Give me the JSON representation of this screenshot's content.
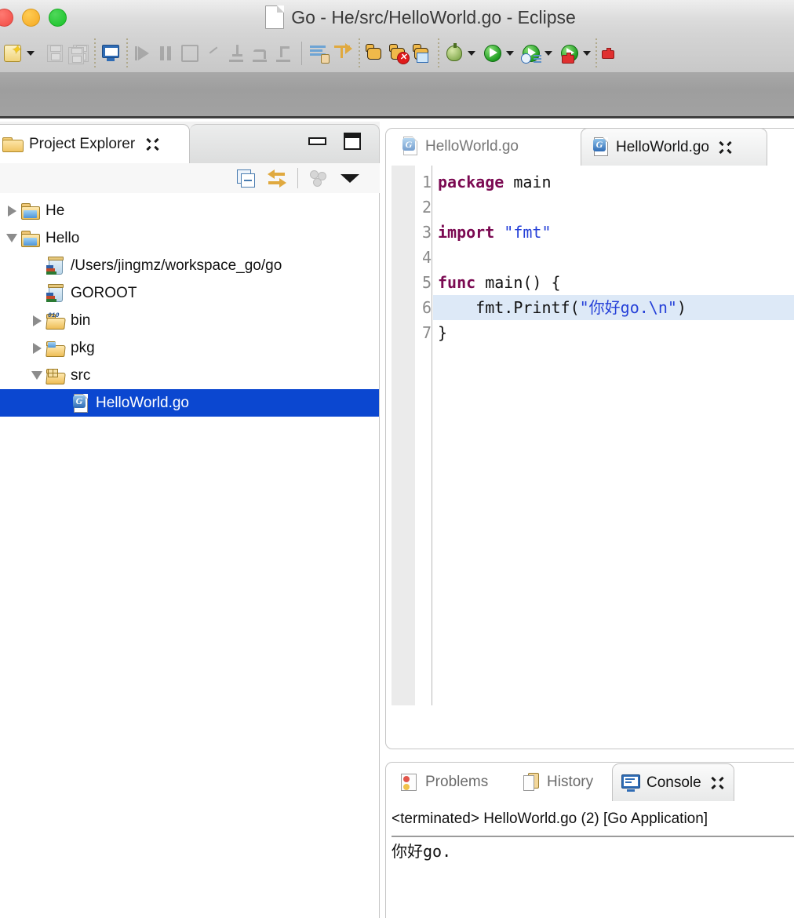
{
  "window": {
    "title": "Go - He/src/HelloWorld.go - Eclipse",
    "doc_icon": "document-icon",
    "traffic_lights": [
      "close",
      "minimize",
      "zoom"
    ]
  },
  "toolbar": {
    "items": [
      {
        "name": "new-wizard-button",
        "icon": "new-icon",
        "dropdown": true,
        "enabled": true
      },
      {
        "name": "save-button",
        "icon": "save-icon",
        "enabled": false
      },
      {
        "name": "save-all-button",
        "icon": "save-all-icon",
        "enabled": false
      },
      {
        "name": "open-console-button",
        "icon": "console-icon",
        "enabled": true
      },
      {
        "name": "resume-button",
        "icon": "play-icon",
        "enabled": false
      },
      {
        "name": "suspend-button",
        "icon": "pause-icon",
        "enabled": false
      },
      {
        "name": "terminate-button",
        "icon": "stop-icon",
        "enabled": false
      },
      {
        "name": "disconnect-button",
        "icon": "disconnect-icon",
        "enabled": false
      },
      {
        "name": "step-into-button",
        "icon": "step-into-icon",
        "enabled": false
      },
      {
        "name": "step-over-button",
        "icon": "step-over-icon",
        "enabled": false
      },
      {
        "name": "step-return-button",
        "icon": "step-return-icon",
        "enabled": false
      },
      {
        "name": "show-whitespace-button",
        "icon": "lines-hand-icon",
        "enabled": true
      },
      {
        "name": "next-annotation-button",
        "icon": "yellow-arrow-icon",
        "enabled": true
      },
      {
        "name": "ant-build-button",
        "icon": "ant-cat-icon",
        "enabled": true
      },
      {
        "name": "ant-clean-button",
        "icon": "ant-cat-error-icon",
        "enabled": true
      },
      {
        "name": "ant-view-button",
        "icon": "ant-cat-view-icon",
        "enabled": true
      },
      {
        "name": "debug-button",
        "icon": "bug-icon",
        "dropdown": true,
        "enabled": true
      },
      {
        "name": "run-button",
        "icon": "run-green-icon",
        "dropdown": true,
        "enabled": true
      },
      {
        "name": "run-history-button",
        "icon": "run-history-icon",
        "dropdown": true,
        "enabled": true
      },
      {
        "name": "external-tools-button",
        "icon": "external-tools-icon",
        "dropdown": true,
        "enabled": true
      }
    ]
  },
  "project_explorer": {
    "tab_label": "Project Explorer",
    "tab_icon": "folder-icon",
    "close_icon": "close-icon",
    "minimize_icon": "minimize-icon",
    "maximize_icon": "maximize-icon",
    "view_toolbar": [
      {
        "name": "collapse-all-button",
        "icon": "collapse-all-icon",
        "enabled": true
      },
      {
        "name": "link-with-editor-button",
        "icon": "link-editor-icon",
        "enabled": true
      },
      {
        "name": "filters-button",
        "icon": "filters-icon",
        "enabled": false
      },
      {
        "name": "view-menu-button",
        "icon": "chevron-down-icon",
        "enabled": true
      }
    ],
    "tree": [
      {
        "label": "He",
        "icon": "project-folder-icon",
        "twisty": "collapsed",
        "indent": 0,
        "selected": false
      },
      {
        "label": "Hello",
        "icon": "project-folder-icon",
        "twisty": "expanded",
        "indent": 0,
        "selected": false
      },
      {
        "label": "/Users/jingmz/workspace_go/go",
        "icon": "library-icon",
        "twisty": "none",
        "indent": 1,
        "selected": false
      },
      {
        "label": "GOROOT",
        "icon": "library-icon",
        "twisty": "none",
        "indent": 1,
        "selected": false
      },
      {
        "label": "bin",
        "icon": "bin-folder-icon",
        "twisty": "collapsed",
        "indent": 1,
        "selected": false
      },
      {
        "label": "pkg",
        "icon": "pkg-folder-icon",
        "twisty": "collapsed",
        "indent": 1,
        "selected": false
      },
      {
        "label": "src",
        "icon": "src-folder-icon",
        "twisty": "expanded",
        "indent": 1,
        "selected": false
      },
      {
        "label": "HelloWorld.go",
        "icon": "go-file-icon",
        "twisty": "none",
        "indent": 2,
        "selected": true
      }
    ],
    "selection_color": "#0b47d0"
  },
  "editor": {
    "tabs": [
      {
        "label": "HelloWorld.go",
        "icon": "go-file-icon",
        "active": false,
        "closable": false
      },
      {
        "label": "HelloWorld.go",
        "icon": "go-file-icon",
        "active": true,
        "closable": true
      }
    ],
    "close_icon": "close-icon",
    "highlighted_line": 6,
    "line_numbers": [
      "1",
      "2",
      "3",
      "4",
      "5",
      "6",
      "7"
    ],
    "lines": [
      {
        "n": 1,
        "tokens": [
          {
            "t": "package ",
            "c": "kw"
          },
          {
            "t": "main",
            "c": ""
          }
        ]
      },
      {
        "n": 2,
        "tokens": [
          {
            "t": "",
            "c": ""
          }
        ]
      },
      {
        "n": 3,
        "tokens": [
          {
            "t": "import ",
            "c": "kw"
          },
          {
            "t": "\"fmt\"",
            "c": "str"
          }
        ]
      },
      {
        "n": 4,
        "tokens": [
          {
            "t": "",
            "c": ""
          }
        ]
      },
      {
        "n": 5,
        "tokens": [
          {
            "t": "func ",
            "c": "kw"
          },
          {
            "t": "main() {",
            "c": ""
          }
        ]
      },
      {
        "n": 6,
        "tokens": [
          {
            "t": "    fmt.Printf(",
            "c": ""
          },
          {
            "t": "\"你好go.\\n\"",
            "c": "str"
          },
          {
            "t": ")",
            "c": ""
          }
        ]
      },
      {
        "n": 7,
        "tokens": [
          {
            "t": "}",
            "c": ""
          }
        ]
      }
    ],
    "colors": {
      "keyword": "#7b0a52",
      "string": "#2540d8",
      "highlight": "#dde9f7"
    }
  },
  "console_panel": {
    "tabs": [
      {
        "label": "Problems",
        "icon": "problems-icon",
        "active": false,
        "closable": false
      },
      {
        "label": "History",
        "icon": "history-icon",
        "active": false,
        "closable": false
      },
      {
        "label": "Console",
        "icon": "console-icon",
        "active": true,
        "closable": true
      }
    ],
    "close_icon": "close-icon",
    "header": "<terminated> HelloWorld.go (2) [Go Application]",
    "output": "你好go."
  }
}
